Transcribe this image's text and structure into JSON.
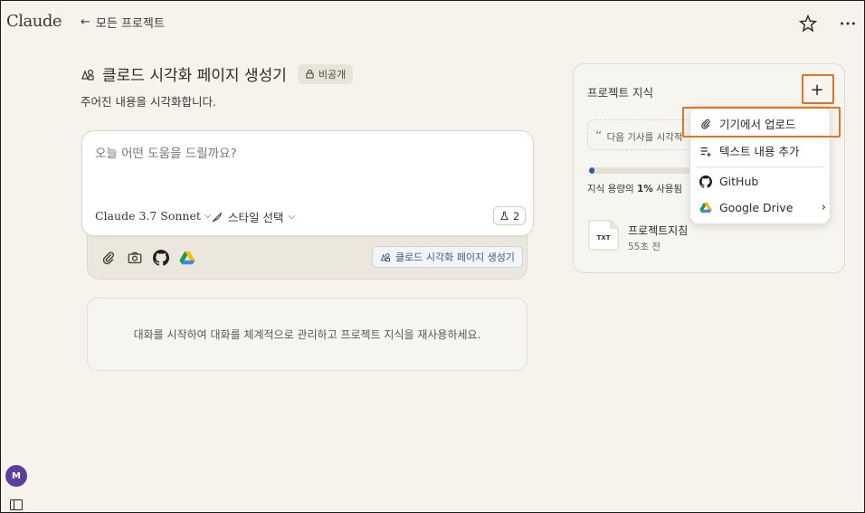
{
  "app": {
    "logo": "Claude"
  },
  "header": {
    "back_label": "모든 프로젝트"
  },
  "project": {
    "title": "클로드 시각화 페이지 생성기",
    "badge": "비공개",
    "description": "주어진 내용을 시각화합니다."
  },
  "composer": {
    "placeholder": "오늘 어떤 도움을 드릴까요?",
    "model": "Claude 3.7 Sonnet",
    "style": "스타일 선택",
    "flask_count": "2",
    "project_chip": "클로드 시각화 페이지 생성기"
  },
  "empty_state": {
    "text": "대화를 시작하여 대화를 체계적으로 관리하고 프로젝트 지식을 재사용하세요."
  },
  "knowledge": {
    "title": "프로젝트 지식",
    "quote_text": "다음 기사를 시각적",
    "capacity_prefix": "지식 용량의 ",
    "capacity_value": "1%",
    "capacity_suffix": " 사용됨",
    "capacity_fraction": 0.01,
    "file": {
      "type_label": "TXT",
      "name": "프로젝트지침",
      "time": "55초 전"
    }
  },
  "menu": {
    "items": [
      {
        "label": "기기에서 업로드",
        "icon": "paperclip-icon"
      },
      {
        "label": "텍스트 내용 추가",
        "icon": "text-add-icon"
      },
      {
        "label": "GitHub",
        "icon": "github-icon"
      },
      {
        "label": "Google Drive",
        "icon": "google-drive-icon"
      }
    ]
  },
  "user": {
    "initial": "M"
  },
  "colors": {
    "accent_highlight": "#e8711e",
    "avatar": "#5d3f9e",
    "progress": "#2d5ba8"
  }
}
